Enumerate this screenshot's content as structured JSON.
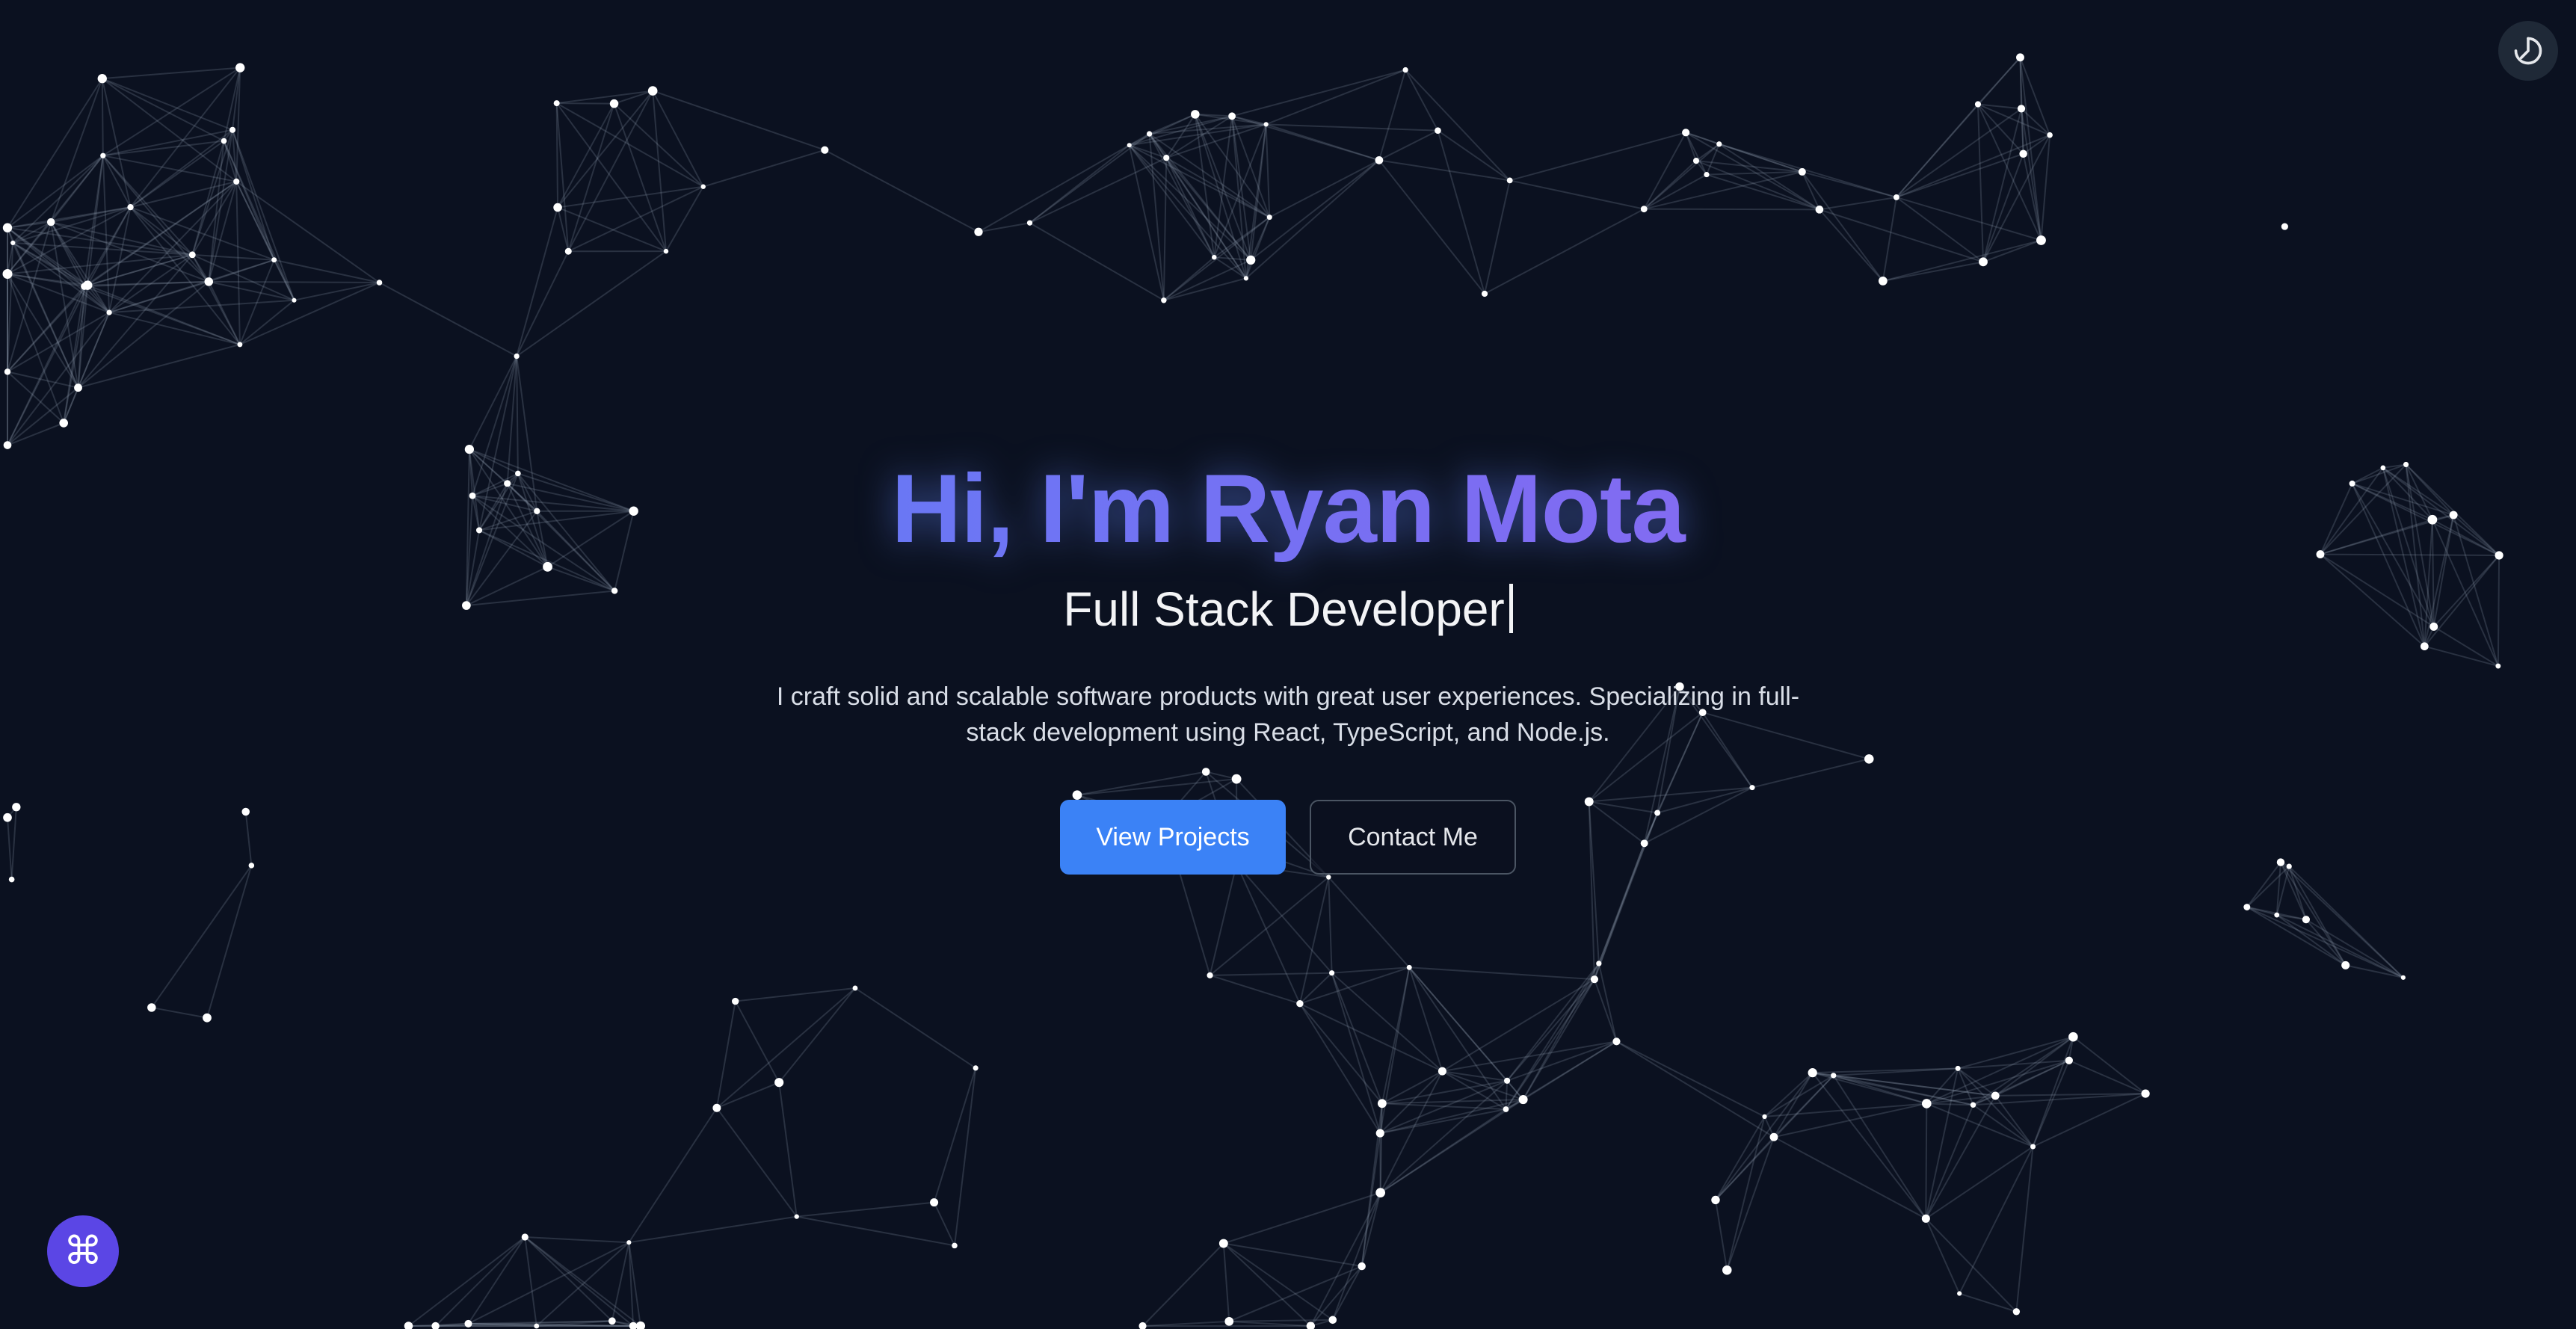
{
  "hero": {
    "title": "Hi, I'm Ryan Mota",
    "subtitle": "Full Stack Developer",
    "description": "I craft solid and scalable software products with great user experiences. Specializing in full-stack development using React, TypeScript, and Node.js."
  },
  "actions": {
    "primary_label": "View Projects",
    "secondary_label": "Contact Me"
  },
  "theme_toggle": {
    "icon": "theme-toggle-icon"
  },
  "command_menu": {
    "glyph": "⌘",
    "icon": "command-icon"
  },
  "colors": {
    "background": "#0b1120",
    "accent_blue": "#3b82f6",
    "gradient_start": "#4f86f7",
    "gradient_end": "#9f6ff0",
    "command_button": "#5b46e5"
  }
}
